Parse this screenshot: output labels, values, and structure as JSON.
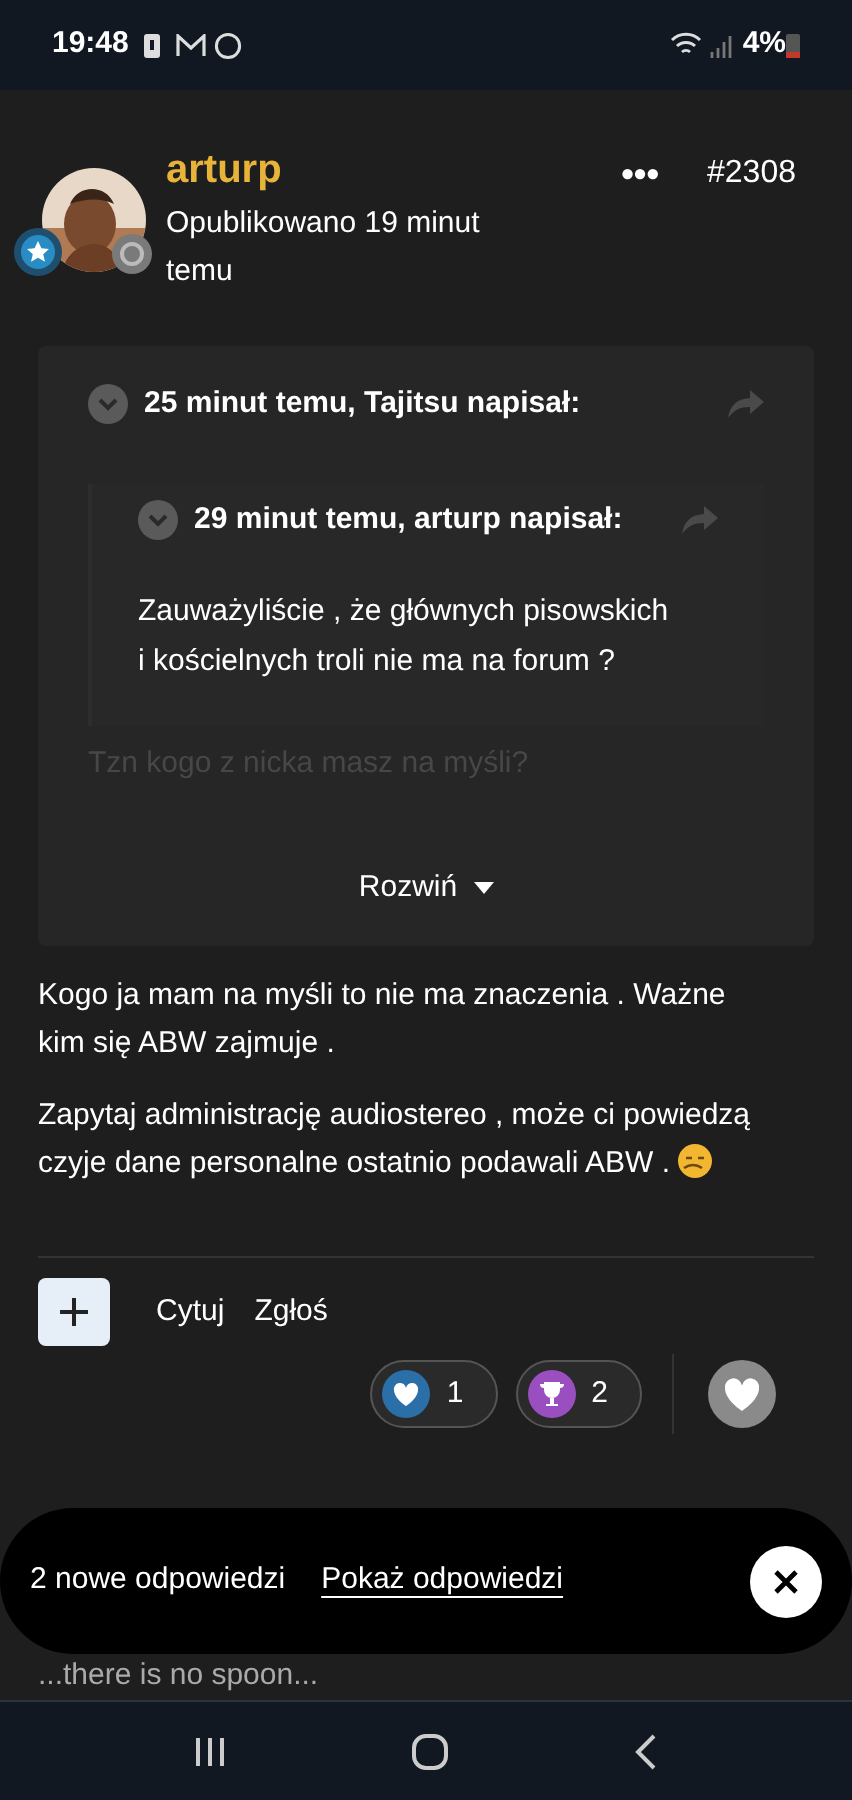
{
  "status_bar": {
    "time": "19:48",
    "battery": "4%"
  },
  "post": {
    "author": "arturp",
    "published": "Opublikowano 19 minut temu",
    "menu": "•••",
    "number": "#2308",
    "quote": {
      "header": "25 minut temu, Tajitsu napisał:",
      "nested_quote": {
        "header": "29 minut temu, arturp napisał:",
        "text": "Zauważyliście , że głównych pisowskich i kościelnych troli nie ma na forum ?"
      },
      "faded_text": "Tzn kogo z nicka masz na myśli?",
      "expand": "Rozwiń"
    },
    "paragraphs": [
      "Kogo ja mam na myśli to nie ma znaczenia . Ważne kim się ABW zajmuje .",
      "Zapytaj administrację audiostereo , może ci powiedzą czyje dane personalne ostatnio podawali ABW ."
    ],
    "actions": [
      "Cytuj",
      "Zgłoś"
    ],
    "reactions": [
      {
        "kind": "heart",
        "color": "#2a6fa8",
        "count": "1"
      },
      {
        "kind": "trophy",
        "color": "#9a4fc0",
        "count": "2"
      }
    ],
    "signature": "...there is no spoon..."
  },
  "snackbar": {
    "message": "2 nowe odpowiedzi",
    "link": "Pokaż odpowiedzi"
  }
}
